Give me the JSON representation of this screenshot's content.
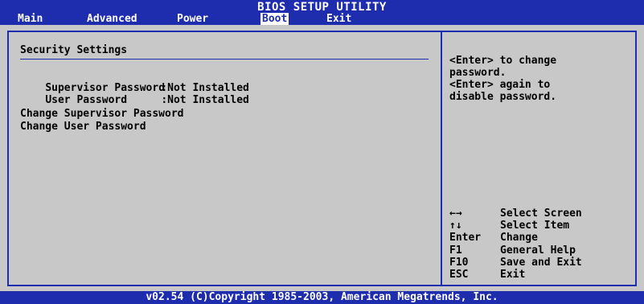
{
  "header": {
    "title": "BIOS SETUP UTILITY",
    "menu": [
      {
        "label": "Main"
      },
      {
        "label": "Advanced"
      },
      {
        "label": "Power"
      },
      {
        "label": "Boot",
        "active": true
      },
      {
        "label": "Exit"
      }
    ]
  },
  "main": {
    "section_title": "Security Settings",
    "status_rows": [
      {
        "label": "Supervisor Password",
        "value": ":Not Installed"
      },
      {
        "label": "User Password",
        "value": ":Not Installed"
      }
    ],
    "actions": [
      {
        "label": "Change Supervisor Password"
      },
      {
        "label": "Change User Password"
      }
    ]
  },
  "help": {
    "lines": [
      "<Enter> to change",
      "password.",
      "<Enter> again to",
      "disable password."
    ]
  },
  "keys": [
    {
      "key": "←→",
      "desc": "Select Screen",
      "icon": "left-right-arrows-icon"
    },
    {
      "key": "↑↓",
      "desc": "Select Item",
      "icon": "up-down-arrows-icon"
    },
    {
      "key": "Enter",
      "desc": "Change"
    },
    {
      "key": "F1",
      "desc": "General Help"
    },
    {
      "key": "F10",
      "desc": "Save and Exit"
    },
    {
      "key": "ESC",
      "desc": "Exit"
    }
  ],
  "footer": {
    "text": "v02.54 (C)Copyright 1985-2003, American Megatrends, Inc."
  },
  "colors": {
    "bar": "#1d2dad",
    "background": "#c8c8c8",
    "text": "#000000",
    "menu_text": "#ffffff"
  }
}
